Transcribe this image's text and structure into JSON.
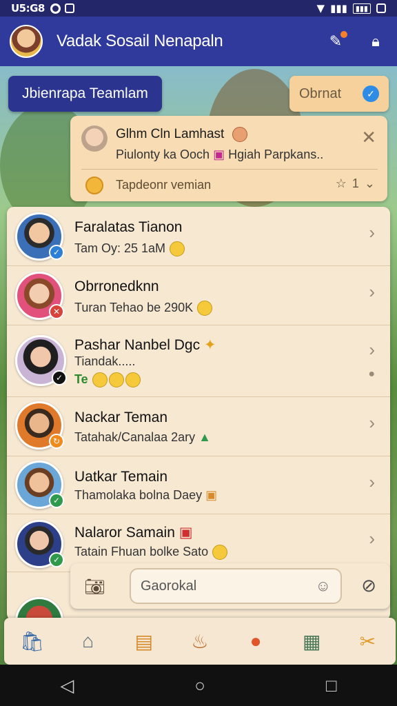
{
  "status_bar": {
    "time": "U5:G8"
  },
  "app_bar": {
    "title": "Vadak Sosail Nenapaln"
  },
  "team_button": {
    "label": "Jbienrapa Teamlam"
  },
  "obtain_button": {
    "label": "Obrnat"
  },
  "notification": {
    "title": "Glhm Cln Lamhast",
    "message": "Piulonty ka Ooch",
    "message_tail": "Hgiah Parpkans..",
    "action": "Tapdeonr vemian",
    "meta": "1"
  },
  "chats": [
    {
      "name": "Faralatas Tianon",
      "subtitle": "Tam Oy: 25 1aM",
      "badge_color": "#2e7fd6"
    },
    {
      "name": "Obrronedknn",
      "subtitle": "Turan Tehao be 290K",
      "badge_color": "#d9433a"
    },
    {
      "name": "Pashar Nanbel Dgc",
      "subtitle": "Tiandak.....",
      "extra": "Te",
      "badge_color": "#111111"
    },
    {
      "name": "Nackar Teman",
      "subtitle": "Tatahak/Canalaa 2ary",
      "badge_color": "#f08a1c"
    },
    {
      "name": "Uatkar Temain",
      "subtitle": "Thamolaka bolna Daey",
      "badge_color": "#2f9a4b"
    },
    {
      "name": "Nalaror Samain",
      "subtitle": "Tatain Fhuan bolke Sato",
      "badge_color": "#2f9a4b"
    }
  ],
  "input": {
    "placeholder": "Gaorokal"
  },
  "colors": {
    "primary": "#303a9c",
    "status_bar": "#23276a",
    "panel": "#f7e8d2",
    "accent": "#f6d19b"
  }
}
